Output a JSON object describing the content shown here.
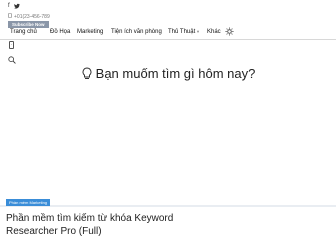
{
  "topbar": {
    "social": [
      "facebook-icon",
      "twitter-icon"
    ],
    "phone": "+01(23-456-789",
    "subscribe_label": "Subscribe Now"
  },
  "nav": {
    "items": [
      {
        "label": "Trang chủ",
        "caret": false
      },
      {
        "label": "Đồ Họa",
        "caret": false
      },
      {
        "label": "Marketing",
        "caret": false
      },
      {
        "label": "Tiện ích văn phòng",
        "caret": false
      },
      {
        "label": "Thủ Thuật",
        "caret": true
      },
      {
        "label": "Khác",
        "caret": false
      }
    ]
  },
  "hero": {
    "question": "Bạn muốm tìm gì hôm nay?"
  },
  "post": {
    "category": "Phần mềm Marketing",
    "title": "Phần mềm tìm kiếm từ khóa Keyword Researcher Pro (Full)"
  },
  "colors": {
    "subscribe_bg": "#8a96a8",
    "badge_bg": "#3a8dd8"
  }
}
